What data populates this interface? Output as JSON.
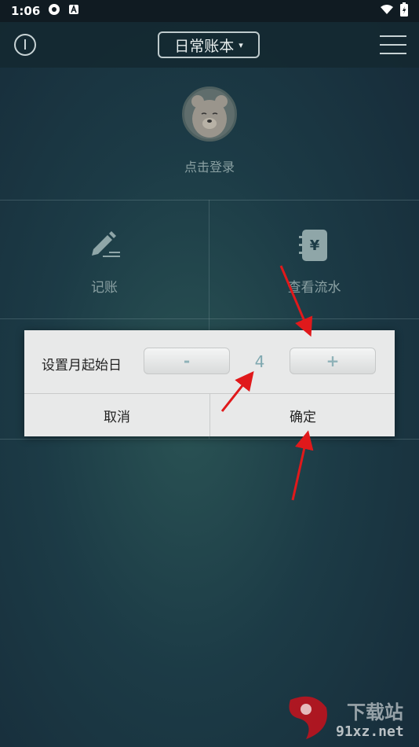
{
  "status_bar": {
    "time": "1:06"
  },
  "header": {
    "title": "日常账本",
    "title_caret": "▾"
  },
  "profile": {
    "login_text": "点击登录"
  },
  "grid": [
    {
      "label": "记账",
      "icon": "pencil-icon"
    },
    {
      "label": "查看流水",
      "icon": "yen-notebook-icon"
    }
  ],
  "dialog": {
    "label": "设置月起始日",
    "minus_label": "-",
    "plus_label": "+",
    "value": "4",
    "cancel_label": "取消",
    "confirm_label": "确定"
  },
  "watermark": {
    "text": "91xz.net",
    "text2": "下载站"
  },
  "colors": {
    "accent": "#7fa8b0",
    "arrow": "#e0191b"
  }
}
